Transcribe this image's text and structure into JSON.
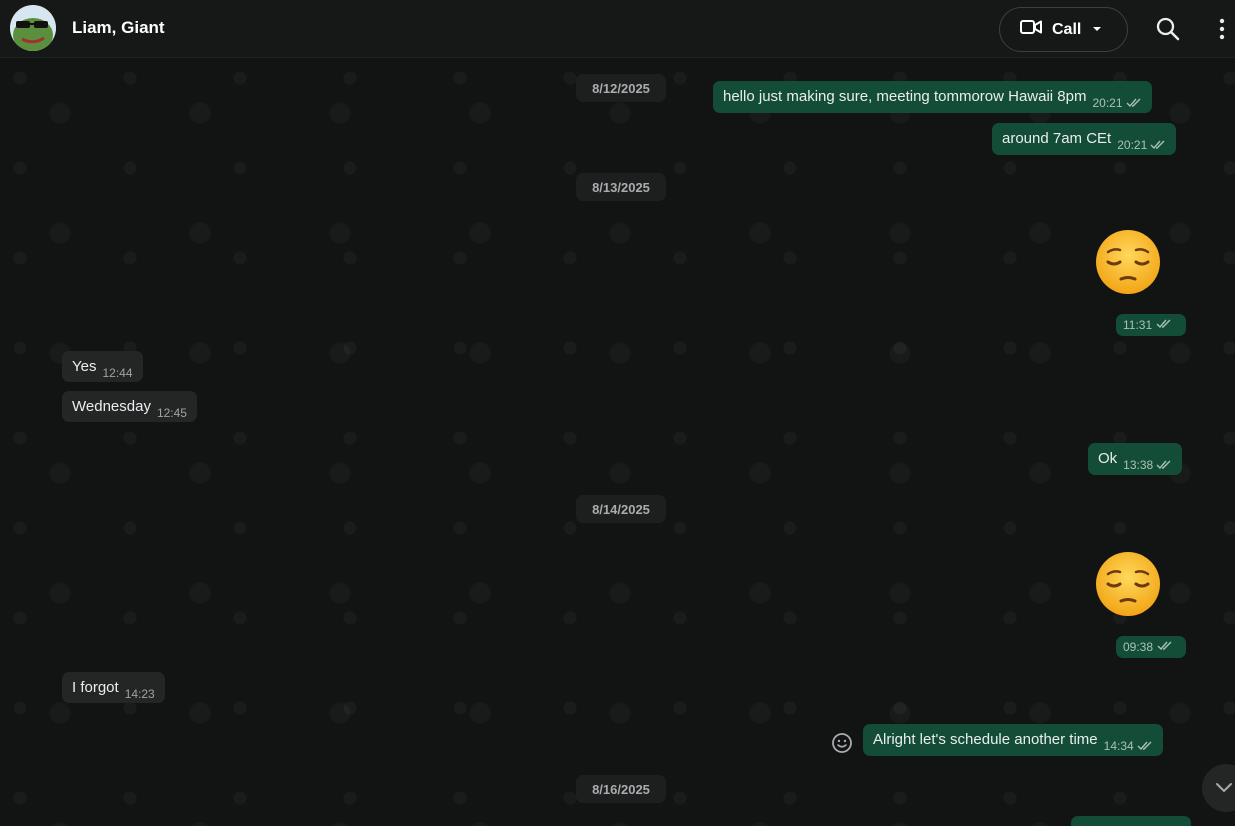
{
  "header": {
    "contact_name": "Liam, Giant",
    "call_label": "Call"
  },
  "messages": {
    "date1": "8/12/2025",
    "m1_text": "hello just making sure, meeting tommorow Hawaii 8pm",
    "m1_time": "20:21",
    "m2_text": "around 7am CEt",
    "m2_time": "20:21",
    "date2": "8/13/2025",
    "e1_time": "11:31",
    "m3_text": "Yes",
    "m3_time": "12:44",
    "m4_text": "Wednesday",
    "m4_time": "12:45",
    "m5_text": "Ok",
    "m5_time": "13:38",
    "date3": "8/14/2025",
    "e2_time": "09:38",
    "m6_text": "I forgot",
    "m6_time": "14:23",
    "m7_text": "Alright let's schedule another time",
    "m7_time": "14:34",
    "date4": "8/16/2025"
  },
  "icons": {
    "video": "video-icon",
    "caret": "chevron-down-icon",
    "search": "search-icon",
    "menu": "more-vertical-icon",
    "ticks": "double-check-icon",
    "emoji": "pensive-face-emoji",
    "smiley": "smiley-icon",
    "scroll": "scroll-down-icon"
  },
  "colors": {
    "outgoing": "#144d37",
    "incoming": "#242626",
    "header": "#161717",
    "tick": "#a8c2b4"
  }
}
